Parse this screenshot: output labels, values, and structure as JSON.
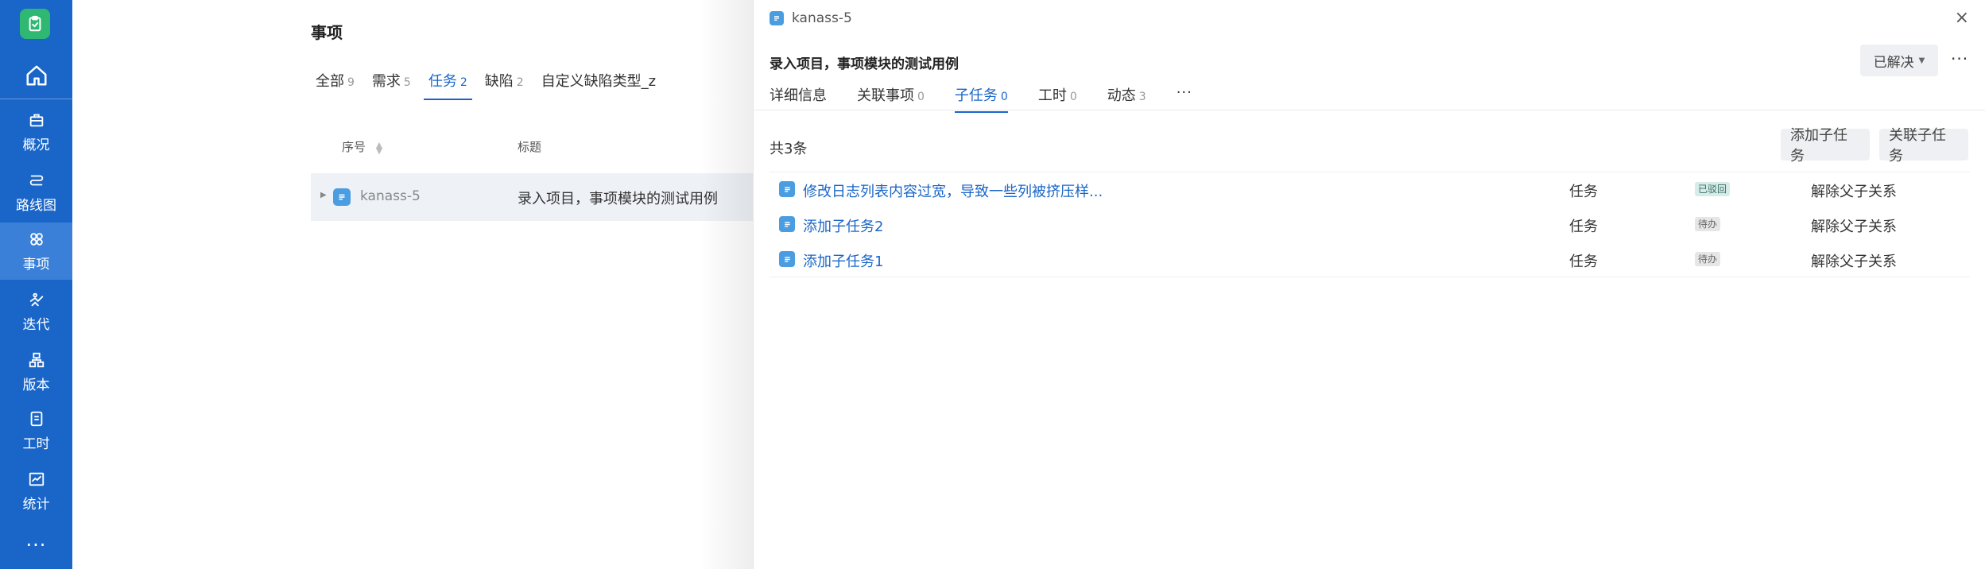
{
  "colors": {
    "sidebar": "#1a66c8",
    "accent": "#1a66c8",
    "logo": "#2eb872",
    "task_icon": "#4a9de0"
  },
  "sidebar": {
    "logo_icon": "clipboard-check-icon",
    "home_icon": "home-icon",
    "items": [
      {
        "label": "概况",
        "icon": "briefcase-icon"
      },
      {
        "label": "路线图",
        "icon": "route-icon"
      },
      {
        "label": "事项",
        "icon": "grid-icon",
        "active": true
      },
      {
        "label": "迭代",
        "icon": "sprint-icon"
      },
      {
        "label": "版本",
        "icon": "version-icon"
      },
      {
        "label": "工时",
        "icon": "timesheet-icon"
      },
      {
        "label": "统计",
        "icon": "chart-icon"
      }
    ],
    "more": "···"
  },
  "main": {
    "title": "事项",
    "tabs": [
      {
        "label": "全部",
        "count": "9"
      },
      {
        "label": "需求",
        "count": "5"
      },
      {
        "label": "任务",
        "count": "2",
        "active": true
      },
      {
        "label": "缺陷",
        "count": "2"
      },
      {
        "label": "自定义缺陷类型_z",
        "count": ""
      }
    ],
    "columns": {
      "index": "序号",
      "title": "标题"
    },
    "rows": [
      {
        "id": "kanass-5",
        "title": "录入项目，事项模块的测试用例"
      }
    ]
  },
  "drawer": {
    "id": "kanass-5",
    "close": "×",
    "title": "录入项目，事项模块的测试用例",
    "status": "已解决",
    "more": "···",
    "tabs": [
      {
        "label": "详细信息",
        "count": ""
      },
      {
        "label": "关联事项",
        "count": "0"
      },
      {
        "label": "子任务",
        "count": "0",
        "active": true
      },
      {
        "label": "工时",
        "count": "0"
      },
      {
        "label": "动态",
        "count": "3"
      }
    ],
    "tabs_more": "···",
    "count_text": "共3条",
    "add_button": "添加子任务",
    "link_button": "关联子任务",
    "subtasks": [
      {
        "title": "修改日志列表内容过宽，导致一些列被挤压样...",
        "type": "任务",
        "status": "已驳回",
        "action": "解除父子关系"
      },
      {
        "title": "添加子任务2",
        "type": "任务",
        "status": "待办",
        "action": "解除父子关系"
      },
      {
        "title": "添加子任务1",
        "type": "任务",
        "status": "待办",
        "action": "解除父子关系"
      }
    ]
  }
}
